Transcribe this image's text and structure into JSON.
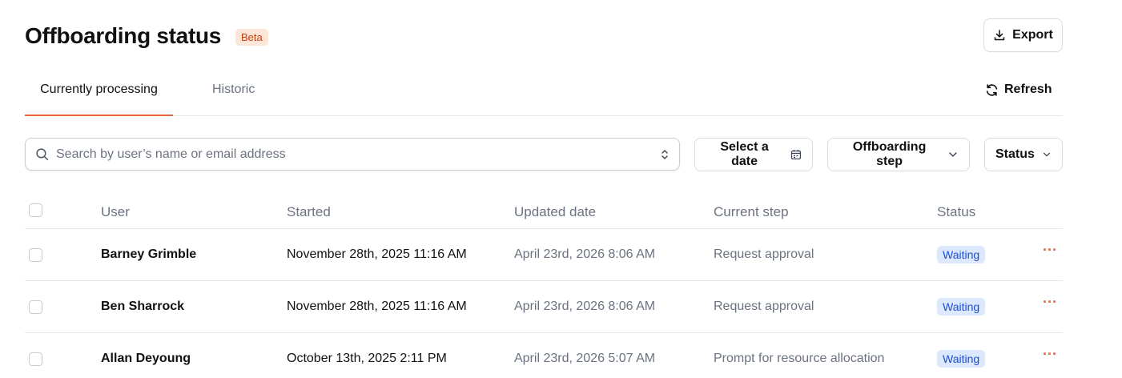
{
  "header": {
    "title": "Offboarding status",
    "badge": "Beta",
    "export_label": "Export"
  },
  "tabs": [
    {
      "label": "Currently processing",
      "active": true
    },
    {
      "label": "Historic",
      "active": false
    }
  ],
  "refresh_label": "Refresh",
  "search": {
    "placeholder": "Search by user’s name or email address",
    "value": ""
  },
  "filters": {
    "date": "Select a date",
    "step": "Offboarding step",
    "status": "Status"
  },
  "table": {
    "columns": [
      "User",
      "Started",
      "Updated date",
      "Current step",
      "Status"
    ],
    "rows": [
      {
        "user": "Barney Grimble",
        "started": "November 28th, 2025 11:16 AM",
        "updated": "April 23rd, 2026 8:06 AM",
        "step": "Request approval",
        "status": "Waiting"
      },
      {
        "user": "Ben Sharrock",
        "started": "November 28th, 2025 11:16 AM",
        "updated": "April 23rd, 2026 8:06 AM",
        "step": "Request approval",
        "status": "Waiting"
      },
      {
        "user": "Allan Deyoung",
        "started": "October 13th, 2025 2:11 PM",
        "updated": "April 23rd, 2026 5:07 AM",
        "step": "Prompt for resource allocation",
        "status": "Waiting"
      }
    ]
  },
  "colors": {
    "accent": "#e8633a",
    "badge_bg": "#fde5d8",
    "status_bg": "#dbe8fd",
    "status_text": "#1d4ed8"
  }
}
